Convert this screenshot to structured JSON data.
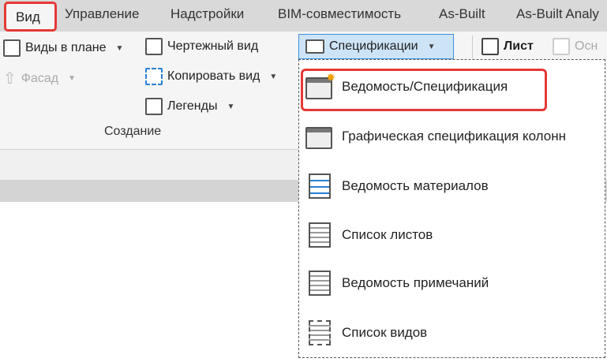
{
  "tabs": [
    {
      "label": "Вид",
      "active": true
    },
    {
      "label": "Управление"
    },
    {
      "label": "Надстройки"
    },
    {
      "label": "BIM-совместимость"
    },
    {
      "label": "As-Built"
    },
    {
      "label": "As-Built Analy"
    }
  ],
  "ribbon": {
    "plan_views": "Виды в плане",
    "elevation": "Фасад",
    "drafting_view": "Чертежный вид",
    "duplicate_view": "Копировать вид",
    "legends": "Легенды",
    "group_label": "Создание",
    "schedules": "Спецификации",
    "sheet": "Лист",
    "title_block": "Осн"
  },
  "menu": {
    "items": [
      {
        "label": "Ведомость/Спецификация",
        "icon": "schedule-new-icon",
        "highlighted": true
      },
      {
        "label": "Графическая спецификация колонн",
        "icon": "column-schedule-icon"
      },
      {
        "label": "Ведомость материалов",
        "icon": "material-takeoff-icon"
      },
      {
        "label": "Список листов",
        "icon": "sheet-list-icon"
      },
      {
        "label": "Ведомость примечаний",
        "icon": "note-block-icon"
      },
      {
        "label": "Список видов",
        "icon": "view-list-icon"
      }
    ]
  },
  "colors": {
    "highlight": "#e53935",
    "accent": "#3c8fd9"
  }
}
